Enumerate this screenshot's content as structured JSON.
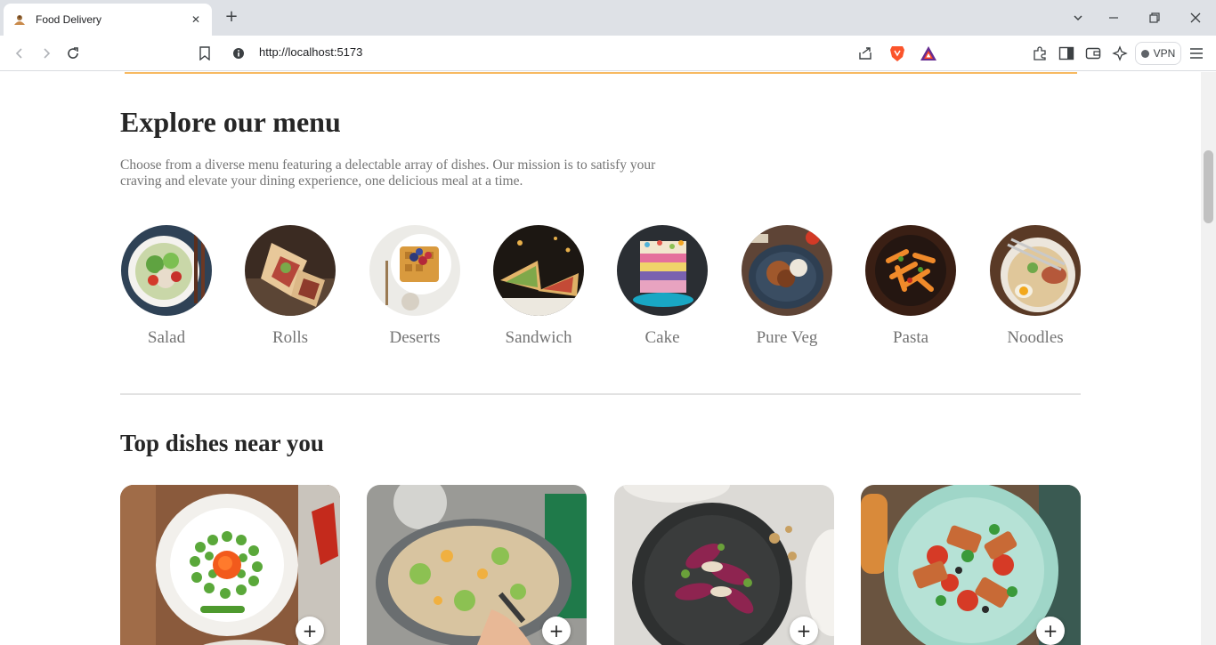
{
  "browser": {
    "tab_title": "Food Delivery",
    "tab_close": "✕",
    "new_tab": "+",
    "url": "http://localhost:5173",
    "vpn_label": "VPN"
  },
  "menu": {
    "title": "Explore our menu",
    "description": "Choose from a diverse menu featuring a delectable array of dishes. Our mission is to satisfy your craving and elevate your dining experience, one delicious meal at a time.",
    "categories": [
      {
        "label": "Salad"
      },
      {
        "label": "Rolls"
      },
      {
        "label": "Deserts"
      },
      {
        "label": "Sandwich"
      },
      {
        "label": "Cake"
      },
      {
        "label": "Pure Veg"
      },
      {
        "label": "Pasta"
      },
      {
        "label": "Noodles"
      }
    ]
  },
  "dishes": {
    "title": "Top dishes near you",
    "add_label": "+"
  },
  "colors": {
    "accent_line": "#f7b961",
    "title_text": "#262626",
    "muted_text": "#747474"
  }
}
